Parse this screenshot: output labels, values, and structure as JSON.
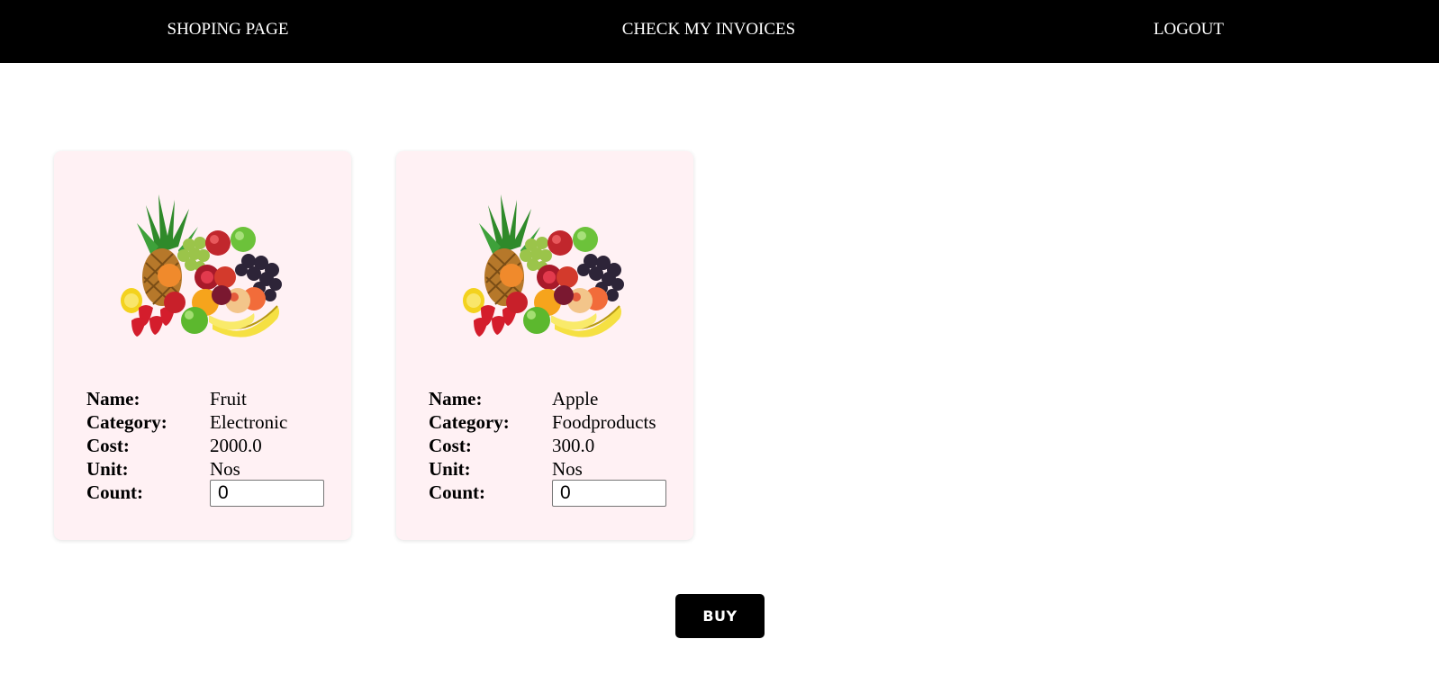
{
  "nav": {
    "shopping": "SHOPING PAGE",
    "invoices": "CHECK MY INVOICES",
    "logout": "LOGOUT"
  },
  "labels": {
    "name": "Name:",
    "category": "Category:",
    "cost": "Cost:",
    "unit": "Unit:",
    "count": "Count:"
  },
  "products": [
    {
      "name": "Fruit",
      "category": "Electronic",
      "cost": "2000.0",
      "unit": "Nos",
      "count": "0",
      "image_icon": "fruit-basket-icon"
    },
    {
      "name": "Apple",
      "category": "Foodproducts",
      "cost": "300.0",
      "unit": "Nos",
      "count": "0",
      "image_icon": "fruit-basket-icon"
    }
  ],
  "buy_label": "BUY",
  "colors": {
    "navbar": "#000000",
    "card_background": "#fff1f4",
    "buy_button": "#000000"
  }
}
